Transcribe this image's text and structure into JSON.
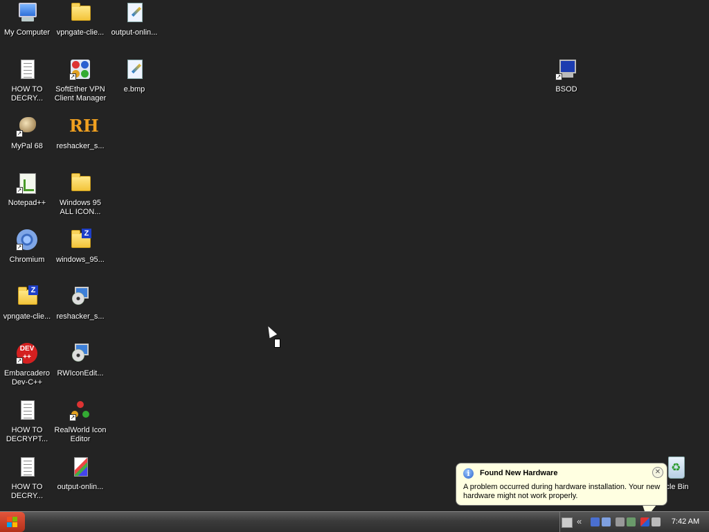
{
  "desktop": {
    "icons": [
      {
        "label": "My Computer"
      },
      {
        "label": "vpngate-clie..."
      },
      {
        "label": "output-onlin..."
      },
      {
        "label": "HOW TO\nDECRY..."
      },
      {
        "label": "SoftEther VPN\nClient Manager"
      },
      {
        "label": "e.bmp"
      },
      {
        "label": "BSOD"
      },
      {
        "label": "MyPal 68"
      },
      {
        "label": "reshacker_s..."
      },
      {
        "label": "Notepad++"
      },
      {
        "label": "Windows 95\nALL ICON..."
      },
      {
        "label": "Chromium"
      },
      {
        "label": "windows_95..."
      },
      {
        "label": "vpngate-clie..."
      },
      {
        "label": "reshacker_s..."
      },
      {
        "label": "Embarcadero\nDev-C++"
      },
      {
        "label": "RWIconEdit..."
      },
      {
        "label": "HOW TO\nDECRYPT..."
      },
      {
        "label": "RealWorld Icon\nEditor"
      },
      {
        "label": "HOW TO\nDECRY..."
      },
      {
        "label": "output-onlin..."
      },
      {
        "label": "ycle Bin"
      }
    ]
  },
  "balloon": {
    "title": "Found New Hardware",
    "message": "A problem occurred during hardware installation. Your new hardware might not work properly.",
    "close_glyph": "✕"
  },
  "taskbar": {
    "tray_chevron": "«",
    "clock": "7:42 AM"
  },
  "icon_glyphs": {
    "dev": "DEV\n++",
    "rh": "RH",
    "zip": "Z",
    "info": "i",
    "shortcut": "↗"
  }
}
